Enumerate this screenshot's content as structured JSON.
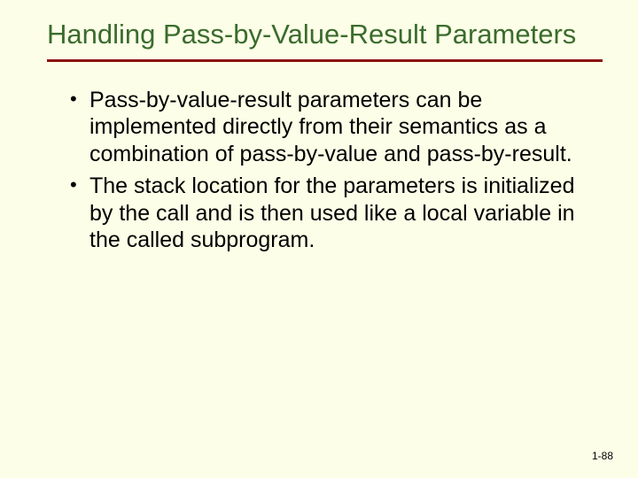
{
  "slide": {
    "title": "Handling Pass-by-Value-Result Parameters",
    "bullets": [
      "Pass-by-value-result parameters can be implemented directly from their semantics as a combination of pass-by-value and pass-by-result.",
      "The stack location for the parameters is initialized by the call and is then used like a local variable in the called subprogram."
    ],
    "page_number": "1-88"
  }
}
